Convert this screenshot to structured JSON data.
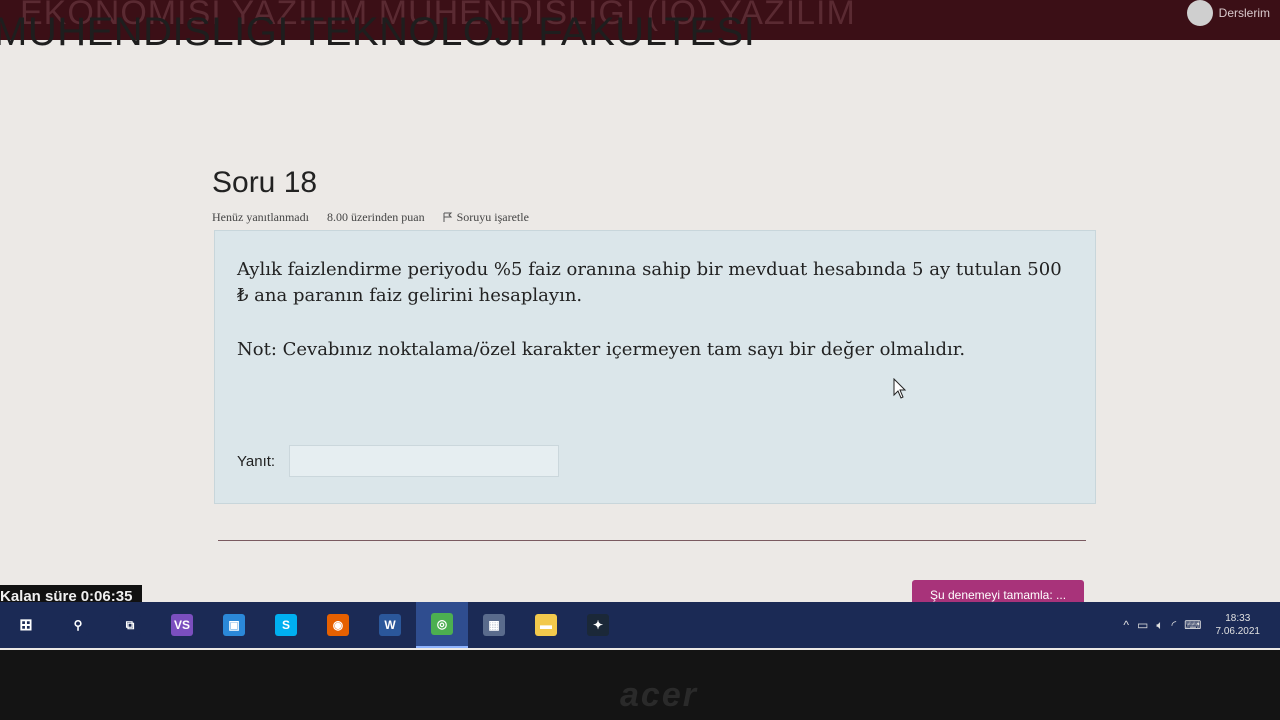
{
  "header": {
    "top_title": "EKONOMISI YAZILIM MUHENDISLIGI (IÖ) YAZILIM",
    "faculty_title": "MUHENDISLIGI TEKNOLOJI FAKULTESI",
    "user_menu_label": "Derslerim"
  },
  "question": {
    "number_label": "Soru 18",
    "status": "Henüz yanıtlanmadı",
    "points": "8.00 üzerinden puan",
    "flag_label": "Soruyu işaretle",
    "text": "Aylık faizlendirme periyodu %5 faiz oranına sahip bir mevduat hesabında 5 ay tutulan 500 ₺ ana paranın faiz gelirini hesaplayın.",
    "note": "Not: Cevabınız noktalama/özel karakter içermeyen tam sayı bir değer olmalıdır.",
    "answer_label": "Yanıt:",
    "answer_value": ""
  },
  "timer": {
    "label": "Kalan süre",
    "value": "0:06:35"
  },
  "finish_button": "Şu denemeyi tamamla: ...",
  "taskbar": {
    "apps": [
      {
        "name": "search-icon",
        "glyph": "⚲",
        "color": "#1b2a55"
      },
      {
        "name": "task-view-icon",
        "glyph": "⧉",
        "color": "#1b2a55"
      },
      {
        "name": "visual-studio-icon",
        "glyph": "VS",
        "color": "#7b4fbf"
      },
      {
        "name": "remote-desktop-icon",
        "glyph": "▣",
        "color": "#2b88d8"
      },
      {
        "name": "skype-icon",
        "glyph": "S",
        "color": "#00aff0"
      },
      {
        "name": "firefox-icon",
        "glyph": "◉",
        "color": "#e66000"
      },
      {
        "name": "word-icon",
        "glyph": "W",
        "color": "#2b579a"
      },
      {
        "name": "chrome-icon",
        "glyph": "◎",
        "color": "#4caf50"
      },
      {
        "name": "calculator-icon",
        "glyph": "▦",
        "color": "#5a6b8c"
      },
      {
        "name": "file-explorer-icon",
        "glyph": "▬",
        "color": "#f2c94c"
      },
      {
        "name": "steam-icon",
        "glyph": "✦",
        "color": "#1b2838"
      }
    ],
    "tray": {
      "time": "18:33",
      "date": "7.06.2021"
    }
  },
  "bezel_brand": "acer"
}
